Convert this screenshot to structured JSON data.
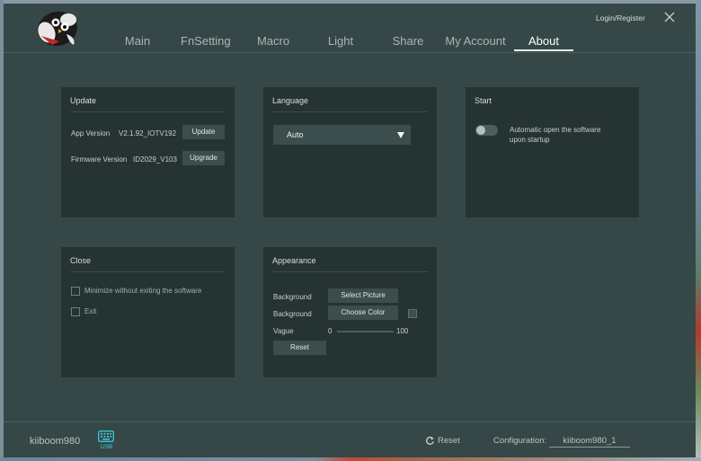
{
  "header": {
    "tabs": [
      {
        "label": "Main",
        "active": false
      },
      {
        "label": "FnSetting",
        "active": false
      },
      {
        "label": "Macro",
        "active": false
      },
      {
        "label": "Light",
        "active": false
      },
      {
        "label": "Share",
        "active": false
      },
      {
        "label": "My Account",
        "active": false
      },
      {
        "label": "About",
        "active": true
      }
    ],
    "login_label": "Login/Register"
  },
  "update_panel": {
    "title": "Update",
    "app_version_label": "App Version",
    "app_version_value": "V2.1.92_IOTV192",
    "update_button": "Update",
    "firmware_version_label": "Firmware Version",
    "firmware_version_value": "ID2029_V103",
    "upgrade_button": "Upgrade"
  },
  "language_panel": {
    "title": "Language",
    "selected": "Auto"
  },
  "start_panel": {
    "title": "Start",
    "auto_open_label_line1": "Automatic open the software",
    "auto_open_label_line2": "upon startup",
    "auto_open_enabled": false
  },
  "close_panel": {
    "title": "Close",
    "minimize_label": "Minimize without exiting the software",
    "minimize_checked": false,
    "exit_label": "Exit",
    "exit_checked": false
  },
  "appearance_panel": {
    "title": "Appearance",
    "background_label_1": "Background",
    "select_picture_button": "Select Picture",
    "background_label_2": "Background",
    "choose_color_button": "Choose Color",
    "vague_label": "Vague",
    "vague_min": "0",
    "vague_max": "100",
    "reset_button": "Reset"
  },
  "footer": {
    "device_name": "kiiboom980",
    "usb_label": "USB",
    "reset_label": "Reset",
    "configuration_label": "Configuration:",
    "configuration_value": "kiiboom980_1"
  },
  "colors": {
    "window_bg": "#354747",
    "panel_bg": "#263333",
    "button_bg": "#3b4d4d",
    "usb_accent": "#3ad4e6"
  }
}
